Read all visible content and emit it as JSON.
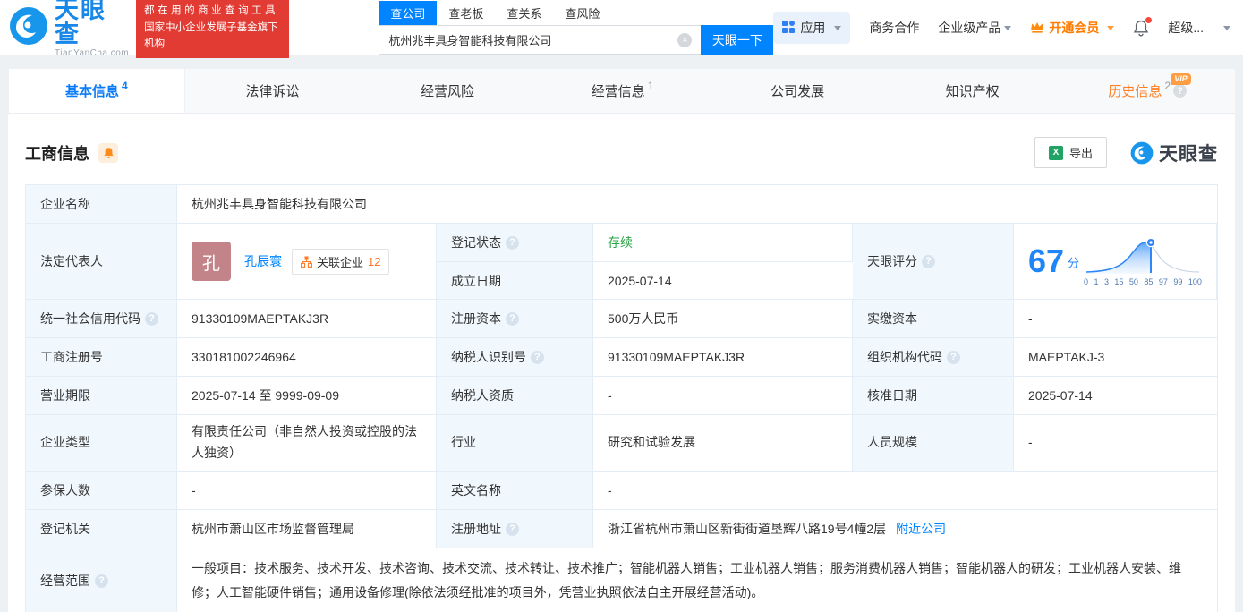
{
  "icons": {
    "help": "?",
    "clear": "×",
    "excel": "X"
  },
  "colors": {
    "brand_blue": "#0084ff",
    "vip_orange": "#ff8026",
    "status_green": "#2ba546",
    "promo_red": "#e23b33",
    "avatar_red": "#c28389"
  },
  "header": {
    "logo_cn": "天眼查",
    "logo_en": "TianYanCha.com",
    "promo_line1": "都在用的商业查询工具",
    "promo_line2": "国家中小企业发展子基金旗下机构",
    "search_tabs": [
      {
        "label": "查公司"
      },
      {
        "label": "查老板"
      },
      {
        "label": "查关系"
      },
      {
        "label": "查风险"
      }
    ],
    "search": {
      "value": "杭州兆丰具身智能科技有限公司",
      "button": "天眼一下"
    },
    "nav": {
      "apps": "应用",
      "cooperation": "商务合作",
      "enterprise_products": "企业级产品",
      "vip": "开通会员",
      "user": "超级..."
    }
  },
  "tabs": [
    {
      "label": "基本信息",
      "count": "4"
    },
    {
      "label": "法律诉讼",
      "count": ""
    },
    {
      "label": "经营风险",
      "count": ""
    },
    {
      "label": "经营信息",
      "count": "1"
    },
    {
      "label": "公司发展",
      "count": ""
    },
    {
      "label": "知识产权",
      "count": ""
    },
    {
      "label": "历史信息",
      "count": "2",
      "vip_badge": "VIP"
    }
  ],
  "section": {
    "title": "工商信息",
    "export_label": "导出",
    "logo_text": "天眼查"
  },
  "info": {
    "company_name": {
      "label": "企业名称",
      "value": "杭州兆丰具身智能科技有限公司"
    },
    "legal_rep": {
      "label": "法定代表人",
      "avatar": "孔",
      "name": "孔辰寰",
      "related_label": "关联企业",
      "related_count": "12"
    },
    "reg_status": {
      "label": "登记状态",
      "value": "存续"
    },
    "establish_date": {
      "label": "成立日期",
      "value": "2025-07-14"
    },
    "score": {
      "label": "天眼评分",
      "value": "67",
      "unit": "分",
      "axis": [
        "0",
        "1",
        "3",
        "15",
        "50",
        "85",
        "97",
        "99",
        "100"
      ]
    },
    "credit_code": {
      "label": "统一社会信用代码",
      "value": "91330109MAEPTAKJ3R"
    },
    "reg_capital": {
      "label": "注册资本",
      "value": "500万人民币"
    },
    "paid_capital": {
      "label": "实缴资本",
      "value": "-"
    },
    "reg_number": {
      "label": "工商注册号",
      "value": "330181002246964"
    },
    "taxpayer_id": {
      "label": "纳税人识别号",
      "value": "91330109MAEPTAKJ3R"
    },
    "org_code": {
      "label": "组织机构代码",
      "value": "MAEPTAKJ-3"
    },
    "business_term": {
      "label": "营业期限",
      "value": "2025-07-14 至 9999-09-09"
    },
    "taxpayer_quality": {
      "label": "纳税人资质",
      "value": "-"
    },
    "approval_date": {
      "label": "核准日期",
      "value": "2025-07-14"
    },
    "company_type": {
      "label": "企业类型",
      "value": "有限责任公司（非自然人投资或控股的法人独资）"
    },
    "industry": {
      "label": "行业",
      "value": "研究和试验发展"
    },
    "staff_size": {
      "label": "人员规模",
      "value": "-"
    },
    "insured_count": {
      "label": "参保人数",
      "value": "-"
    },
    "english_name": {
      "label": "英文名称",
      "value": "-"
    },
    "reg_authority": {
      "label": "登记机关",
      "value": "杭州市萧山区市场监督管理局"
    },
    "reg_address": {
      "label": "注册地址",
      "value": "浙江省杭州市萧山区新街街道垦辉八路19号4幢2层",
      "nearby_link": "附近公司"
    },
    "business_scope": {
      "label": "经营范围",
      "value": "一般项目：技术服务、技术开发、技术咨询、技术交流、技术转让、技术推广；智能机器人销售；工业机器人销售；服务消费机器人销售；智能机器人的研发；工业机器人安装、维修；人工智能硬件销售；通用设备修理(除依法须经批准的项目外，凭营业执照依法自主开展经营活动)。"
    }
  }
}
